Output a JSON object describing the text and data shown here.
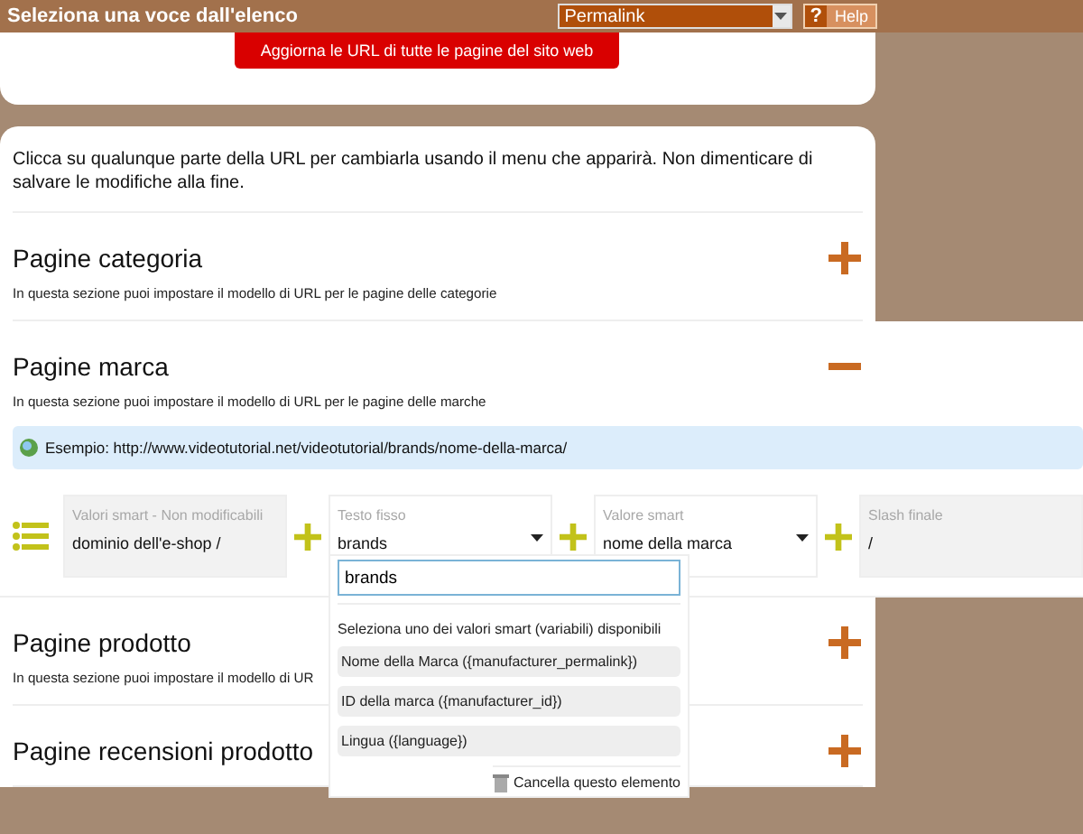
{
  "top_bar": {
    "title": "Seleziona una voce dall'elenco",
    "select_value": "Permalink",
    "help_icon_text": "?",
    "help_label": "Help"
  },
  "update_button": "Aggiorna le URL di tutte le pagine del sito web",
  "instructions": "Clicca su qualunque parte della URL per cambiarla usando il menu che apparirà. Non dimenticare di salvare le modifiche alla fine.",
  "sections": [
    {
      "title": "Pagine categoria",
      "description": "In questa sezione puoi impostare il modello di URL per le pagine delle categorie",
      "expanded": false
    },
    {
      "title": "Pagine marca",
      "description": "In questa sezione puoi impostare il modello di URL per le pagine delle marche",
      "expanded": true,
      "example": "Esempio: http://www.videotutorial.net/videotutorial/brands/nome-della-marca/",
      "segments": [
        {
          "kind": "locked",
          "label": "Valori smart - Non modificabili",
          "value": "dominio dell'e-shop /"
        },
        {
          "kind": "dropdown",
          "label": "Testo fisso",
          "value": "brands",
          "open": true
        },
        {
          "kind": "dropdown",
          "label": "Valore smart",
          "value": "nome della marca",
          "open": false
        },
        {
          "kind": "locked",
          "label": "Slash finale",
          "value": "/"
        }
      ]
    },
    {
      "title": "Pagine prodotto",
      "description": "In questa sezione puoi impostare il modello di UR",
      "expanded": false
    },
    {
      "title": "Pagine recensioni prodotto",
      "expanded": false
    }
  ],
  "popup": {
    "input_value": "brands",
    "heading": "Seleziona uno dei valori smart (variabili) disponibili",
    "options": [
      "Nome della Marca ({manufacturer_permalink})",
      "ID della marca ({manufacturer_id})",
      "Lingua ({language})"
    ],
    "delete_label": "Cancella questo elemento"
  }
}
